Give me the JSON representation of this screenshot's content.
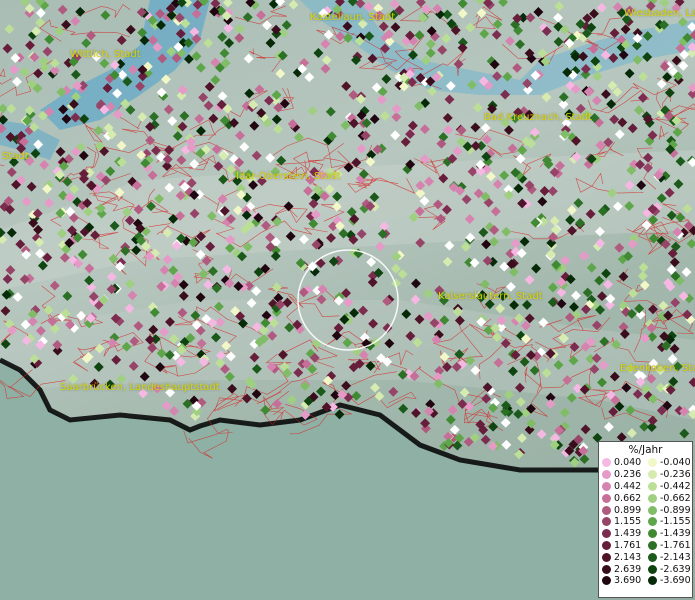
{
  "legend": {
    "title": "%/Jahr",
    "positive": [
      {
        "label": "0.040",
        "color": "#f5b8e3"
      },
      {
        "label": "0.236",
        "color": "#e69ac8"
      },
      {
        "label": "0.442",
        "color": "#d584af"
      },
      {
        "label": "0.662",
        "color": "#c66f98"
      },
      {
        "label": "0.899",
        "color": "#b05a80"
      },
      {
        "label": "1.155",
        "color": "#964468"
      },
      {
        "label": "1.439",
        "color": "#7c2d4f"
      },
      {
        "label": "1.761",
        "color": "#661e3b"
      },
      {
        "label": "2.143",
        "color": "#4f1429"
      },
      {
        "label": "2.639",
        "color": "#3a0d1c"
      },
      {
        "label": "3.690",
        "color": "#1f0610"
      }
    ],
    "negative": [
      {
        "label": "-0.040",
        "color": "#f2f7c8"
      },
      {
        "label": "-0.236",
        "color": "#d6ebb0"
      },
      {
        "label": "-0.442",
        "color": "#bcdf98"
      },
      {
        "label": "-0.662",
        "color": "#9fcf80"
      },
      {
        "label": "-0.899",
        "color": "#80bd66"
      },
      {
        "label": "-1.155",
        "color": "#5fa64b"
      },
      {
        "label": "-1.439",
        "color": "#418a34"
      },
      {
        "label": "-1.761",
        "color": "#2c7026"
      },
      {
        "label": "-2.143",
        "color": "#1b5a1a"
      },
      {
        "label": "-2.639",
        "color": "#0f4410"
      },
      {
        "label": "-3.690",
        "color": "#062a08"
      }
    ]
  },
  "places": {
    "kastellaun": "Kastellaun, Stadt",
    "wiesbaden": "Wiesbaden, La",
    "wittlich": "Wittlich, Stadt",
    "bad_kreuznach": "Bad Kreuznach, Stadt",
    "left_stadt": "Stadt",
    "idar_oberstein": "Idar-Oberstein, Stadt",
    "kaiserslautern": "Kaiserslautern, Stadt",
    "saarbruecken": "Saarbrücken, Landeshauptstadt",
    "edenkoben": "Edenkoben, Sta"
  }
}
